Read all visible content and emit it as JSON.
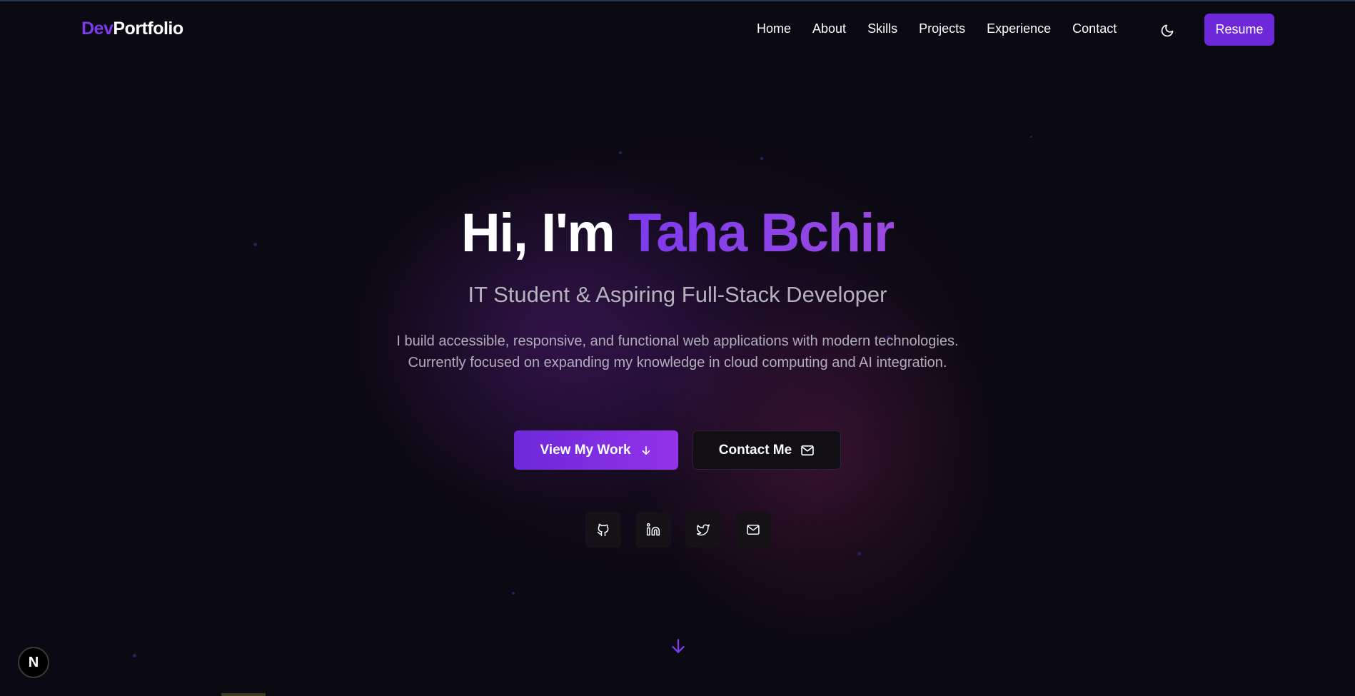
{
  "header": {
    "logo_dev": "Dev",
    "logo_portfolio": "Portfolio",
    "nav": [
      "Home",
      "About",
      "Skills",
      "Projects",
      "Experience",
      "Contact"
    ],
    "theme_icon": "moon-icon",
    "resume_label": "Resume"
  },
  "hero": {
    "greeting": "Hi, I'm ",
    "name": "Taha Bchir",
    "subtitle": "IT Student & Aspiring Full-Stack Developer",
    "description": "I build accessible, responsive, and functional web applications with modern technologies. Currently focused on expanding my knowledge in cloud computing and AI integration.",
    "primary_button": "View My Work",
    "secondary_button": "Contact Me"
  },
  "social": [
    "github-icon",
    "linkedin-icon",
    "twitter-icon",
    "mail-icon"
  ],
  "badge_letter": "N",
  "colors": {
    "accent": "#7c3aed",
    "background": "#0b0911",
    "muted_text": "#b4b2bd"
  }
}
